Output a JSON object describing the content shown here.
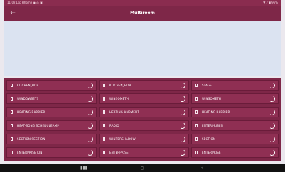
{
  "status_bar": {
    "left_text": "11:02  Lsp  Hhome  ◉  ◎  ▣",
    "right_text": "▼ ⟋ ▮ 96%"
  },
  "header": {
    "back_icon": "arrow-left-icon",
    "title": "Multiroom"
  },
  "tiles": {
    "col1": [
      "KITCHEN_HOB",
      "WINDOWSETS",
      "HEATING BARRIER",
      "HEAT-SONG SCHEDULEAMP",
      "SECTION SECTION",
      "ENTERPRISE KIN"
    ],
    "col2": [
      "KITCHEN_HOB",
      "WINSOMETH",
      "HEATING AMPMENT",
      "RADIO",
      "WINTERSHADOW",
      "ENTERPRISE"
    ],
    "col3": [
      "STAGE",
      "WINSOMETH",
      "HEATING BARRIER",
      "ENTERPRISEN",
      "SECTION",
      "ENTERPRISE"
    ]
  },
  "nav_bar": {
    "recent": "▮▮▮",
    "home": "○",
    "back": "‹"
  }
}
